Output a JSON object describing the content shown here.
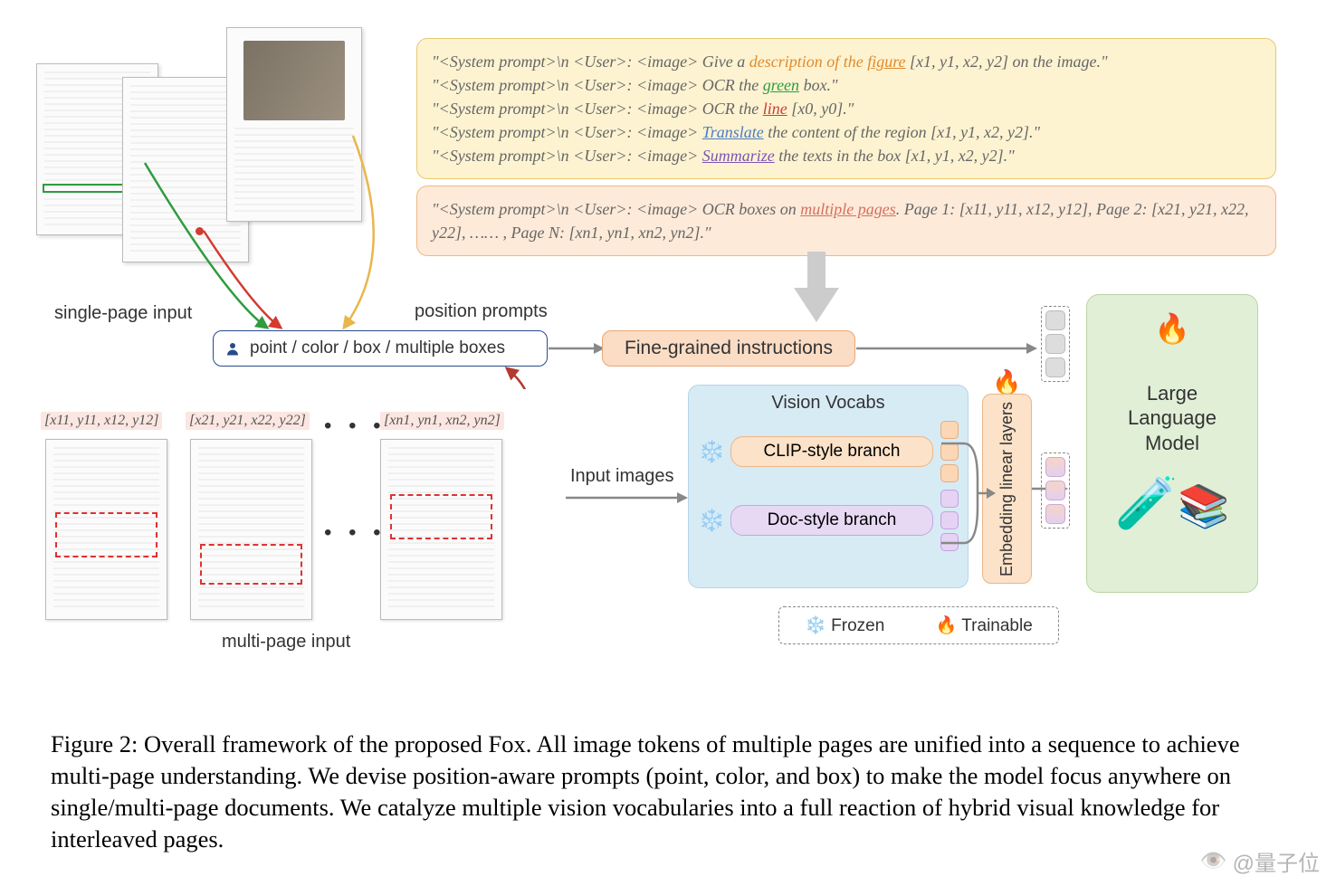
{
  "prompts": {
    "boxA": {
      "p1a": "\"<System prompt>\\n <User>: <image> Give a ",
      "p1b": "description of the ",
      "p1c": "figure",
      "p1d": " [x1, y1, x2, y2] on the image.\"",
      "p2a": "\"<System prompt>\\n <User>: <image> OCR the ",
      "p2b": "green",
      "p2c": " box.\"",
      "p3a": "\"<System prompt>\\n <User>: <image> OCR the ",
      "p3b": "line",
      "p3c": " [x0, y0].\"",
      "p4a": "\"<System prompt>\\n <User>: <image> ",
      "p4b": "Translate",
      "p4c": " the content of the region [x1, y1, x2, y2].\"",
      "p5a": "\"<System prompt>\\n <User>: <image> ",
      "p5b": "Summarize",
      "p5c": " the texts in the box [x1, y1, x2, y2].\""
    },
    "boxB": {
      "b1a": "\"<System prompt>\\n <User>: <image> OCR boxes on ",
      "b1b": "multiple pages",
      "b1c": ". Page 1: [x11, y11, x12, y12], Page 2: [x21, y21, x22, y22], …… , Page N: [xn1, yn1, xn2, yn2].\""
    }
  },
  "labels": {
    "single_page": "single-page input",
    "multi_page": "multi-page input",
    "position_prompts": "position prompts",
    "pp_text": "point / color / box / multiple boxes",
    "fine_grained": "Fine-grained instructions",
    "input_images": "Input images",
    "vision_vocabs": "Vision Vocabs",
    "clip_branch": "CLIP-style branch",
    "doc_branch": "Doc-style branch",
    "embedding": "Embedding linear layers",
    "llm": "Large Language Model",
    "frozen": "Frozen",
    "trainable": "Trainable"
  },
  "coords": {
    "c1": "[x11, y11, x12, y12]",
    "c2": "[x21, y21, x22, y22]",
    "cn": "[xn1, yn1, xn2, yn2]"
  },
  "caption": "Figure 2: Overall framework of the proposed Fox. All image tokens of multiple pages are unified into a sequence to achieve multi-page understanding. We devise position-aware prompts (point, color, and box) to make the model focus anywhere on single/multi-page documents. We catalyze multiple vision vocabularies into a full reaction of hybrid visual knowledge for interleaved pages.",
  "watermark": "@量子位"
}
